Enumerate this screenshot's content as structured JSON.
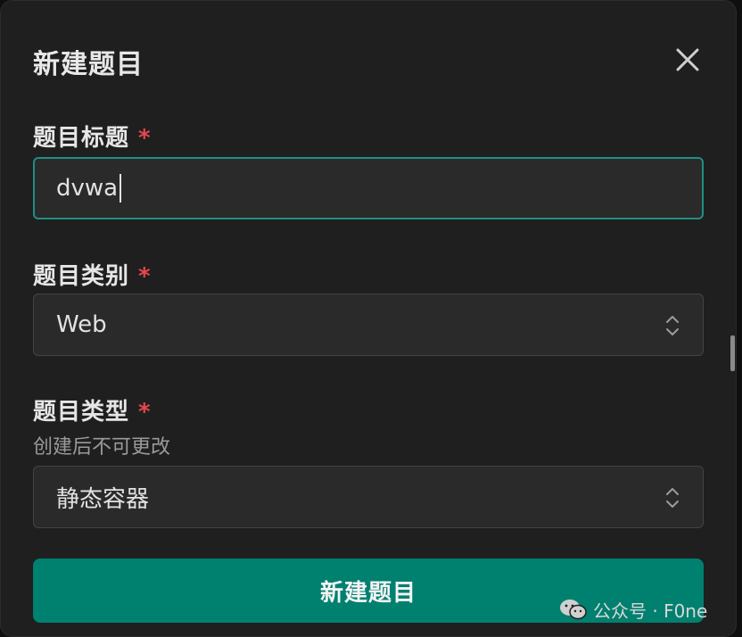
{
  "dialog": {
    "title": "新建题目",
    "close_icon": "close-icon"
  },
  "form": {
    "title_field": {
      "label": "题目标题",
      "required_mark": "*",
      "value": "dvwa"
    },
    "category_field": {
      "label": "题目类别",
      "required_mark": "*",
      "value": "Web",
      "icon": "chevron-updown-icon"
    },
    "type_field": {
      "label": "题目类型",
      "required_mark": "*",
      "hint": "创建后不可更改",
      "value": "静态容器",
      "icon": "chevron-updown-icon"
    },
    "submit_label": "新建题目"
  },
  "watermark": {
    "text": "公众号 · F0ne",
    "icon": "wechat-icon"
  },
  "colors": {
    "accent": "#00806f",
    "focus_border": "#1f8f7f",
    "required": "#e5484d",
    "background": "#1f1f20"
  }
}
